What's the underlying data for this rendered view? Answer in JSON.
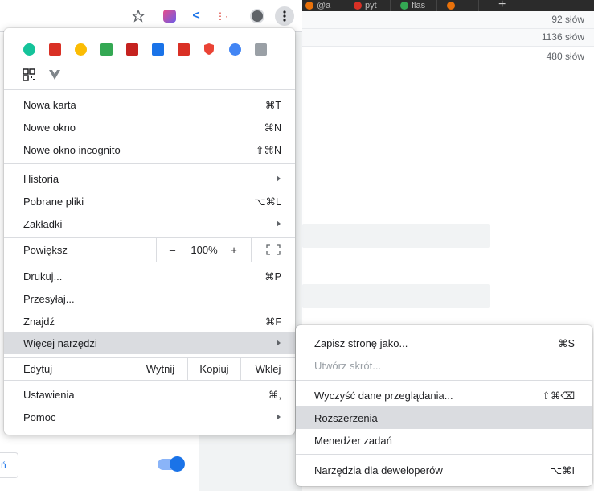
{
  "background": {
    "tabs": [
      {
        "title": "@a",
        "color": "#e8710a"
      },
      {
        "title": "pyt",
        "color": "#d93025"
      },
      {
        "title": "flas",
        "color": "#34a853"
      },
      {
        "title": "",
        "color": "#e8710a"
      }
    ],
    "word_counts": [
      "92 słów",
      "1136 słów",
      "480 słów"
    ],
    "left_panel_link": "ń"
  },
  "extensions": [
    {
      "name": "grammarly-icon",
      "color": "#15c39a"
    },
    {
      "name": "dots-extension-icon",
      "color": "#d93025"
    },
    {
      "name": "chrome-extension-icon",
      "color": "#fbbc04"
    },
    {
      "name": "arrow-extension-icon",
      "color": "#34a853"
    },
    {
      "name": "red-arrow-extension-icon",
      "color": "#c5221f"
    },
    {
      "name": "window-extension-icon",
      "color": "#1a73e8"
    },
    {
      "name": "pen-extension-icon",
      "color": "#d93025"
    },
    {
      "name": "shield-extension-icon",
      "color": "#ea4335"
    },
    {
      "name": "globe-extension-icon",
      "color": "#4285f4"
    },
    {
      "name": "gray-extension-icon",
      "color": "#9aa0a6"
    },
    {
      "name": "qr-code-icon",
      "color": "#202124"
    },
    {
      "name": "vue-extension-icon",
      "color": "#80868b"
    }
  ],
  "menu": {
    "new_tab": {
      "label": "Nowa karta",
      "shortcut": "⌘T"
    },
    "new_window": {
      "label": "Nowe okno",
      "shortcut": "⌘N"
    },
    "new_incognito": {
      "label": "Nowe okno incognito",
      "shortcut": "⇧⌘N"
    },
    "history": {
      "label": "Historia"
    },
    "downloads": {
      "label": "Pobrane pliki",
      "shortcut": "⌥⌘L"
    },
    "bookmarks": {
      "label": "Zakładki"
    },
    "zoom": {
      "label": "Powiększ",
      "minus": "–",
      "value": "100%",
      "plus": "+"
    },
    "print": {
      "label": "Drukuj...",
      "shortcut": "⌘P"
    },
    "cast": {
      "label": "Przesyłaj..."
    },
    "find": {
      "label": "Znajdź",
      "shortcut": "⌘F"
    },
    "more_tools": {
      "label": "Więcej narzędzi"
    },
    "edit": {
      "label": "Edytuj",
      "cut": "Wytnij",
      "copy": "Kopiuj",
      "paste": "Wklej"
    },
    "settings": {
      "label": "Ustawienia",
      "shortcut": "⌘,"
    },
    "help": {
      "label": "Pomoc"
    }
  },
  "submenu": {
    "save_page": {
      "label": "Zapisz stronę jako...",
      "shortcut": "⌘S"
    },
    "create_shortcut": {
      "label": "Utwórz skrót..."
    },
    "clear_data": {
      "label": "Wyczyść dane przeglądania...",
      "shortcut": "⇧⌘⌫"
    },
    "extensions": {
      "label": "Rozszerzenia"
    },
    "task_manager": {
      "label": "Menedżer zadań"
    },
    "dev_tools": {
      "label": "Narzędzia dla deweloperów",
      "shortcut": "⌥⌘I"
    }
  }
}
